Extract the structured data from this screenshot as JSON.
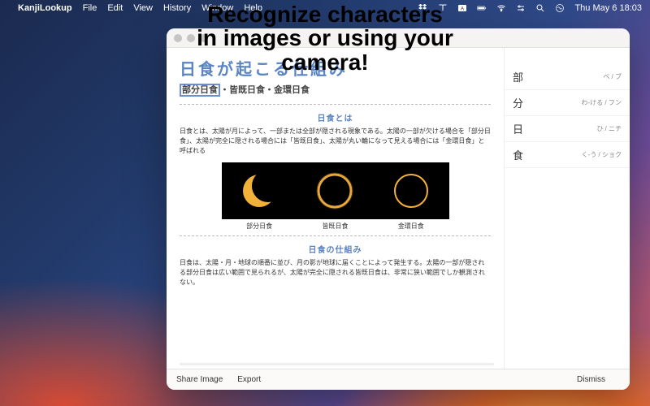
{
  "menubar": {
    "app": "KanjiLookup",
    "items": [
      "File",
      "Edit",
      "View",
      "History",
      "Window",
      "Help"
    ],
    "clock": "Thu May 6  18:03"
  },
  "overlay": {
    "line1": "Recognize characters",
    "line2": "in images or using your",
    "line3": "camera!"
  },
  "content": {
    "title": "日食が起こる仕組み",
    "selected": "部分日食",
    "subtitle_rest": "・皆既日食・金環日食",
    "section1_title": "日食とは",
    "section1_body": "日食とは、太陽が月によって、一部または全部が隠される現象である。太陽の一部が欠ける場合を「部分日食」、太陽が完全に隠される場合には「皆既日食」、太陽が丸い輪になって見える場合には「金環日食」と呼ばれる",
    "captions": [
      "部分日食",
      "皆既日食",
      "金環日食"
    ],
    "section2_title": "日食の仕組み",
    "section2_body": "日食は、太陽・月・地球の順番に並び、月の影が地球に届くことによって発生する。太陽の一部が隠される部分日食は広い範囲で見られるが、太陽が完全に隠される皆既日食は、非常に狭い範囲でしか観測されない。"
  },
  "lookup": [
    {
      "kanji": "部",
      "reading": "ベ   /   ブ"
    },
    {
      "kanji": "分",
      "reading": "わ-ける  /  フン"
    },
    {
      "kanji": "日",
      "reading": "ひ  /  ニチ"
    },
    {
      "kanji": "食",
      "reading": "く-う  /  ショク"
    }
  ],
  "bottom": {
    "share": "Share Image",
    "export": "Export",
    "dismiss": "Dismiss"
  }
}
